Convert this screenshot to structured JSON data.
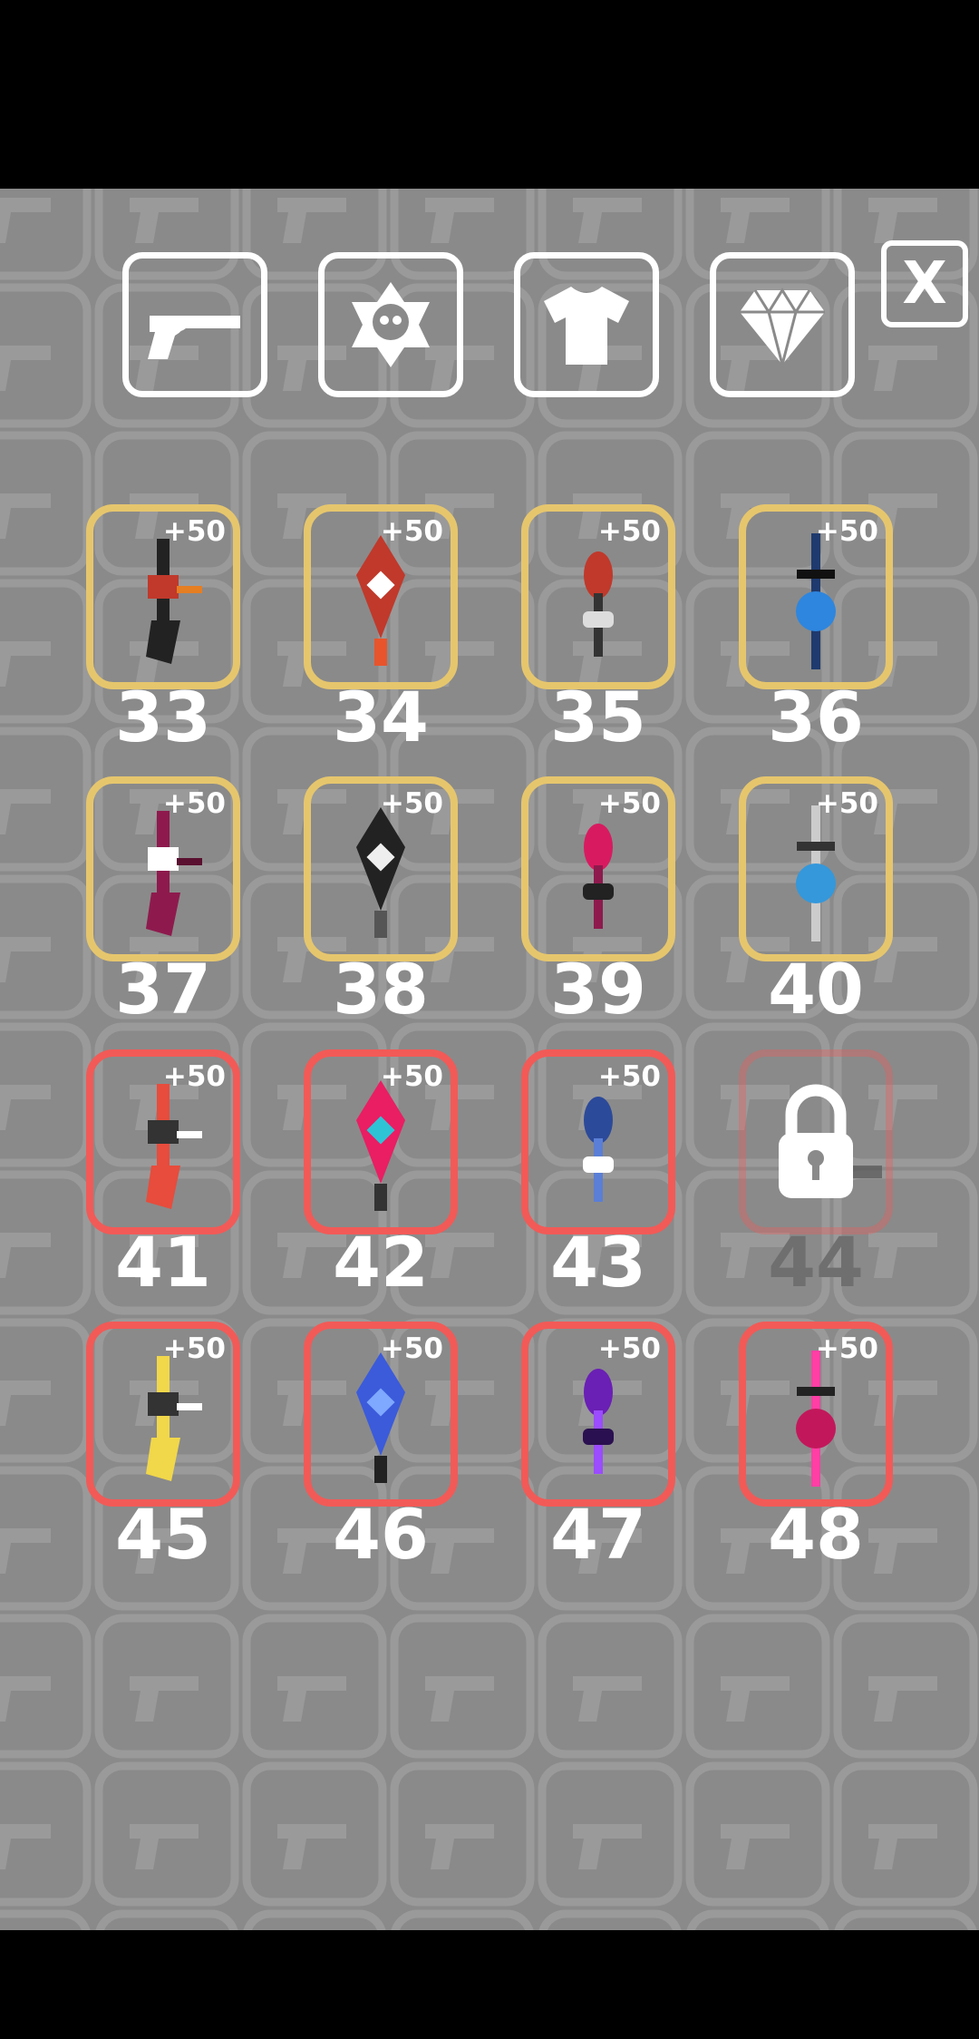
{
  "header": {
    "tabs": [
      {
        "name": "weapons",
        "icon": "revolver-icon"
      },
      {
        "name": "skull-badge",
        "icon": "skull-badge-icon"
      },
      {
        "name": "shirt",
        "icon": "shirt-icon"
      },
      {
        "name": "diamond",
        "icon": "diamond-icon"
      }
    ],
    "close_label": "X"
  },
  "slots": [
    {
      "number": "33",
      "bonus": "+50",
      "tier": "gold",
      "locked": false
    },
    {
      "number": "34",
      "bonus": "+50",
      "tier": "gold",
      "locked": false
    },
    {
      "number": "35",
      "bonus": "+50",
      "tier": "gold",
      "locked": false
    },
    {
      "number": "36",
      "bonus": "+50",
      "tier": "gold",
      "locked": false
    },
    {
      "number": "37",
      "bonus": "+50",
      "tier": "gold",
      "locked": false
    },
    {
      "number": "38",
      "bonus": "+50",
      "tier": "gold",
      "locked": false
    },
    {
      "number": "39",
      "bonus": "+50",
      "tier": "gold",
      "locked": false
    },
    {
      "number": "40",
      "bonus": "+50",
      "tier": "gold",
      "locked": false
    },
    {
      "number": "41",
      "bonus": "+50",
      "tier": "red",
      "locked": false
    },
    {
      "number": "42",
      "bonus": "+50",
      "tier": "red",
      "locked": false
    },
    {
      "number": "43",
      "bonus": "+50",
      "tier": "red",
      "locked": false
    },
    {
      "number": "44",
      "bonus": "",
      "tier": "red",
      "locked": true
    },
    {
      "number": "45",
      "bonus": "+50",
      "tier": "red",
      "locked": false
    },
    {
      "number": "46",
      "bonus": "+50",
      "tier": "red",
      "locked": false
    },
    {
      "number": "47",
      "bonus": "+50",
      "tier": "red",
      "locked": false
    },
    {
      "number": "48",
      "bonus": "+50",
      "tier": "red",
      "locked": false
    }
  ],
  "colors": {
    "gold_border": "#e6c66d",
    "red_border": "#f25a57",
    "background": "#8a8a8a"
  }
}
